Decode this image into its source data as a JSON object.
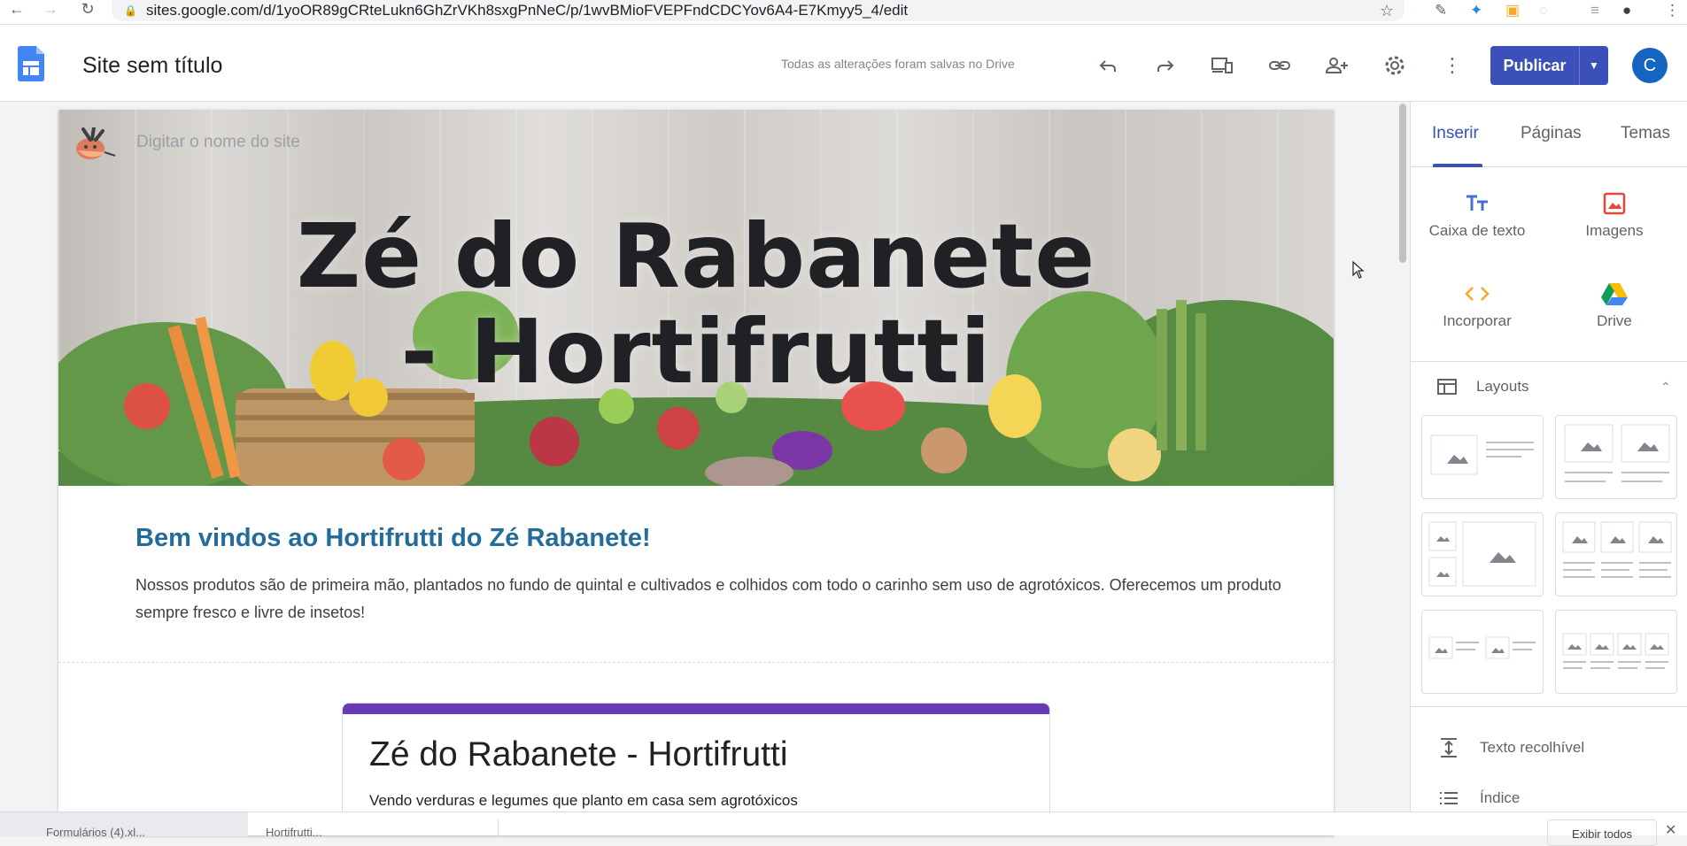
{
  "browser": {
    "url": "sites.google.com/d/1yoOR89gCRteLukn6GhZrVKh8sxgPnNeC/p/1wvBMioFVEPFndCDCYov6A4-E7Kmyy5_4/edit"
  },
  "header": {
    "title": "Site sem título",
    "save_status": "Todas as alterações foram salvas no Drive",
    "publish_label": "Publicar",
    "avatar_initial": "C"
  },
  "site": {
    "name_placeholder": "Digitar o nome do site",
    "hero_title_line1": "Zé do Rabanete",
    "hero_title_line2": "- Hortifrutti",
    "welcome_heading": "Bem vindos ao Hortifrutti do Zé Rabanete!",
    "intro_text": "Nossos produtos são de primeira mão, plantados no fundo de quintal e cultivados e colhidos com todo o carinho sem uso de agrotóxicos. Oferecemos um produto sempre fresco e livre de insetos!",
    "form": {
      "title": "Zé do Rabanete - Hortifrutti",
      "description": "Vendo verduras e legumes que planto em casa sem agrotóxicos",
      "accent_color": "#673ab7"
    },
    "heading_color": "#236c9a"
  },
  "panel": {
    "tabs": [
      "Inserir",
      "Páginas",
      "Temas"
    ],
    "active_tab": "Inserir",
    "insert_items": [
      {
        "label": "Caixa de texto",
        "icon": "text-box-icon"
      },
      {
        "label": "Imagens",
        "icon": "image-icon"
      },
      {
        "label": "Incorporar",
        "icon": "embed-icon"
      },
      {
        "label": "Drive",
        "icon": "drive-icon"
      }
    ],
    "layouts_label": "Layouts",
    "actions": [
      {
        "label": "Texto recolhível",
        "icon": "collapsible-text-icon"
      },
      {
        "label": "Índice",
        "icon": "table-of-contents-icon"
      }
    ],
    "accent_color": "#3b50b9"
  },
  "downloads": {
    "item1": "Formulários (4).xl...",
    "item2": "Hortifrutti...",
    "show_all": "Exibir todos"
  }
}
